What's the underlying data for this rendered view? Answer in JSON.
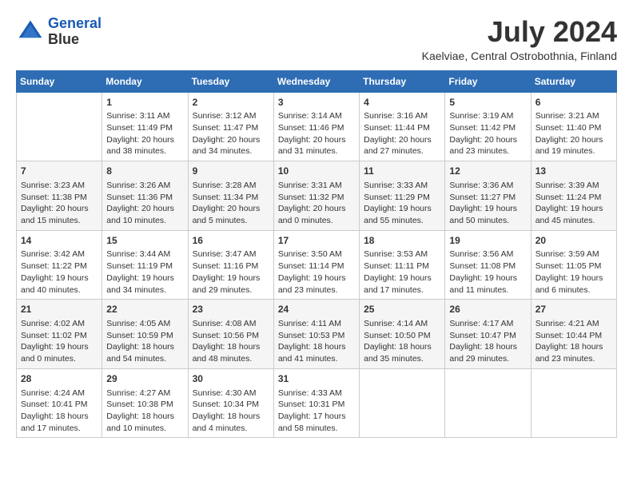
{
  "logo": {
    "line1": "General",
    "line2": "Blue"
  },
  "title": "July 2024",
  "subtitle": "Kaelviae, Central Ostrobothnia, Finland",
  "days_of_week": [
    "Sunday",
    "Monday",
    "Tuesday",
    "Wednesday",
    "Thursday",
    "Friday",
    "Saturday"
  ],
  "weeks": [
    [
      {
        "day": "",
        "info": ""
      },
      {
        "day": "1",
        "info": "Sunrise: 3:11 AM\nSunset: 11:49 PM\nDaylight: 20 hours\nand 38 minutes."
      },
      {
        "day": "2",
        "info": "Sunrise: 3:12 AM\nSunset: 11:47 PM\nDaylight: 20 hours\nand 34 minutes."
      },
      {
        "day": "3",
        "info": "Sunrise: 3:14 AM\nSunset: 11:46 PM\nDaylight: 20 hours\nand 31 minutes."
      },
      {
        "day": "4",
        "info": "Sunrise: 3:16 AM\nSunset: 11:44 PM\nDaylight: 20 hours\nand 27 minutes."
      },
      {
        "day": "5",
        "info": "Sunrise: 3:19 AM\nSunset: 11:42 PM\nDaylight: 20 hours\nand 23 minutes."
      },
      {
        "day": "6",
        "info": "Sunrise: 3:21 AM\nSunset: 11:40 PM\nDaylight: 20 hours\nand 19 minutes."
      }
    ],
    [
      {
        "day": "7",
        "info": "Sunrise: 3:23 AM\nSunset: 11:38 PM\nDaylight: 20 hours\nand 15 minutes."
      },
      {
        "day": "8",
        "info": "Sunrise: 3:26 AM\nSunset: 11:36 PM\nDaylight: 20 hours\nand 10 minutes."
      },
      {
        "day": "9",
        "info": "Sunrise: 3:28 AM\nSunset: 11:34 PM\nDaylight: 20 hours\nand 5 minutes."
      },
      {
        "day": "10",
        "info": "Sunrise: 3:31 AM\nSunset: 11:32 PM\nDaylight: 20 hours\nand 0 minutes."
      },
      {
        "day": "11",
        "info": "Sunrise: 3:33 AM\nSunset: 11:29 PM\nDaylight: 19 hours\nand 55 minutes."
      },
      {
        "day": "12",
        "info": "Sunrise: 3:36 AM\nSunset: 11:27 PM\nDaylight: 19 hours\nand 50 minutes."
      },
      {
        "day": "13",
        "info": "Sunrise: 3:39 AM\nSunset: 11:24 PM\nDaylight: 19 hours\nand 45 minutes."
      }
    ],
    [
      {
        "day": "14",
        "info": "Sunrise: 3:42 AM\nSunset: 11:22 PM\nDaylight: 19 hours\nand 40 minutes."
      },
      {
        "day": "15",
        "info": "Sunrise: 3:44 AM\nSunset: 11:19 PM\nDaylight: 19 hours\nand 34 minutes."
      },
      {
        "day": "16",
        "info": "Sunrise: 3:47 AM\nSunset: 11:16 PM\nDaylight: 19 hours\nand 29 minutes."
      },
      {
        "day": "17",
        "info": "Sunrise: 3:50 AM\nSunset: 11:14 PM\nDaylight: 19 hours\nand 23 minutes."
      },
      {
        "day": "18",
        "info": "Sunrise: 3:53 AM\nSunset: 11:11 PM\nDaylight: 19 hours\nand 17 minutes."
      },
      {
        "day": "19",
        "info": "Sunrise: 3:56 AM\nSunset: 11:08 PM\nDaylight: 19 hours\nand 11 minutes."
      },
      {
        "day": "20",
        "info": "Sunrise: 3:59 AM\nSunset: 11:05 PM\nDaylight: 19 hours\nand 6 minutes."
      }
    ],
    [
      {
        "day": "21",
        "info": "Sunrise: 4:02 AM\nSunset: 11:02 PM\nDaylight: 19 hours\nand 0 minutes."
      },
      {
        "day": "22",
        "info": "Sunrise: 4:05 AM\nSunset: 10:59 PM\nDaylight: 18 hours\nand 54 minutes."
      },
      {
        "day": "23",
        "info": "Sunrise: 4:08 AM\nSunset: 10:56 PM\nDaylight: 18 hours\nand 48 minutes."
      },
      {
        "day": "24",
        "info": "Sunrise: 4:11 AM\nSunset: 10:53 PM\nDaylight: 18 hours\nand 41 minutes."
      },
      {
        "day": "25",
        "info": "Sunrise: 4:14 AM\nSunset: 10:50 PM\nDaylight: 18 hours\nand 35 minutes."
      },
      {
        "day": "26",
        "info": "Sunrise: 4:17 AM\nSunset: 10:47 PM\nDaylight: 18 hours\nand 29 minutes."
      },
      {
        "day": "27",
        "info": "Sunrise: 4:21 AM\nSunset: 10:44 PM\nDaylight: 18 hours\nand 23 minutes."
      }
    ],
    [
      {
        "day": "28",
        "info": "Sunrise: 4:24 AM\nSunset: 10:41 PM\nDaylight: 18 hours\nand 17 minutes."
      },
      {
        "day": "29",
        "info": "Sunrise: 4:27 AM\nSunset: 10:38 PM\nDaylight: 18 hours\nand 10 minutes."
      },
      {
        "day": "30",
        "info": "Sunrise: 4:30 AM\nSunset: 10:34 PM\nDaylight: 18 hours\nand 4 minutes."
      },
      {
        "day": "31",
        "info": "Sunrise: 4:33 AM\nSunset: 10:31 PM\nDaylight: 17 hours\nand 58 minutes."
      },
      {
        "day": "",
        "info": ""
      },
      {
        "day": "",
        "info": ""
      },
      {
        "day": "",
        "info": ""
      }
    ]
  ]
}
